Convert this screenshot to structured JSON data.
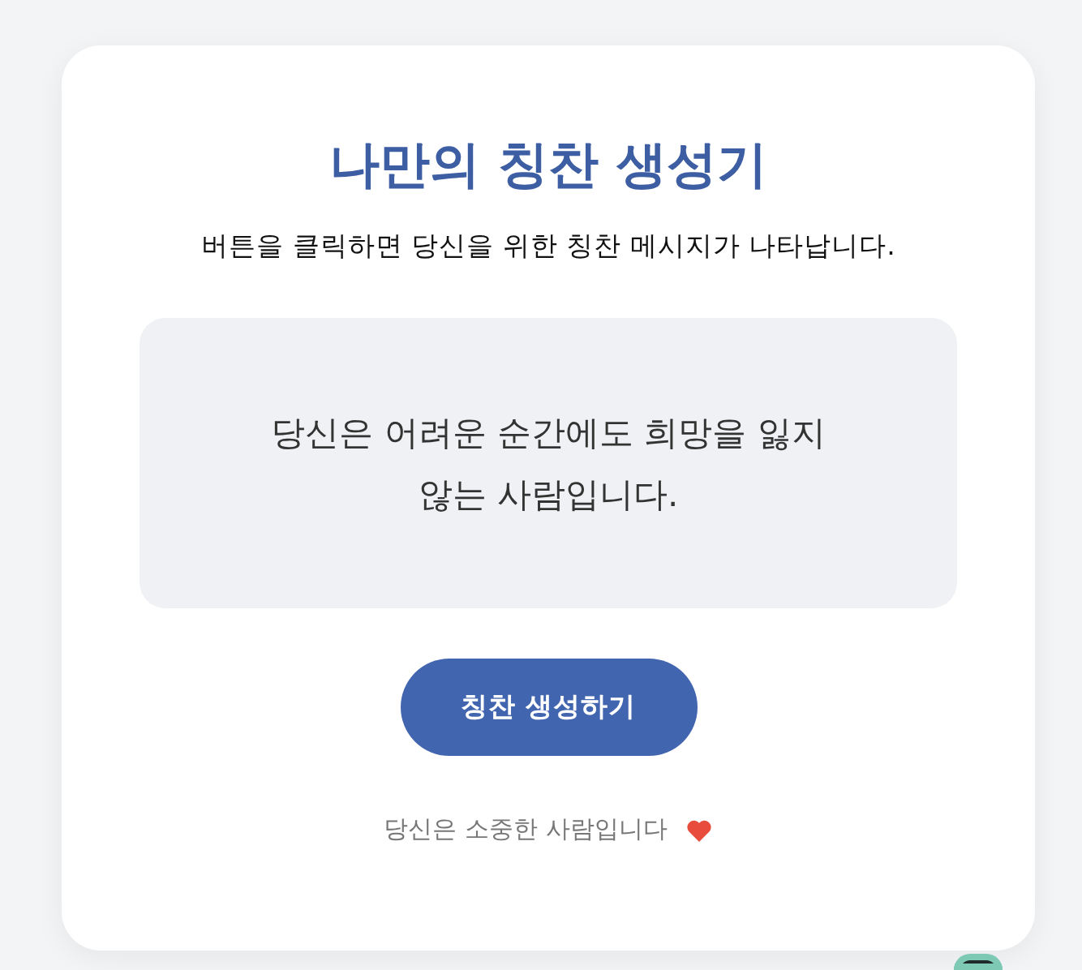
{
  "title": "나만의 칭찬 생성기",
  "subtitle": "버튼을 클릭하면 당신을 위한 칭찬 메시지가 나타납니다.",
  "message": "당신은 어려운 순간에도 희망을 잃지 않는 사람입니다.",
  "button": {
    "label": "칭찬 생성하기"
  },
  "footer": {
    "text": "당신은 소중한 사람입니다"
  }
}
